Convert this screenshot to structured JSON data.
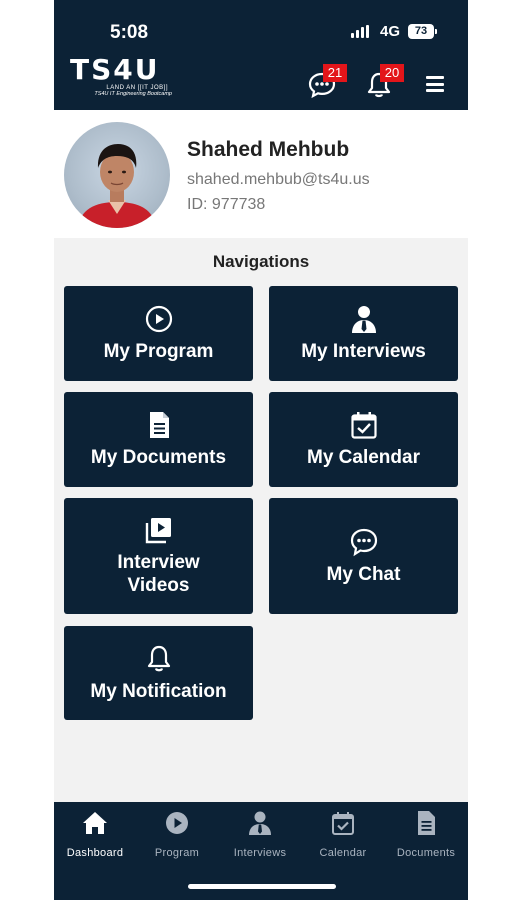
{
  "status_bar": {
    "time": "5:08",
    "network": "4G",
    "battery": "73"
  },
  "header": {
    "logo_text": "TS4U",
    "logo_tagline": "LAND AN [[IT JOB]]",
    "logo_subtitle": "TS4U IT Engineering Bootcamp",
    "chat_badge": "21",
    "notification_badge": "20"
  },
  "profile": {
    "name": "Shahed Mehbub",
    "email": "shahed.mehbub@ts4u.us",
    "id_text": "ID: 977738"
  },
  "navigations": {
    "title": "Navigations",
    "tiles": [
      {
        "label": "My Program",
        "icon": "play-circle-icon"
      },
      {
        "label": "My Interviews",
        "icon": "user-tie-icon"
      },
      {
        "label": "My Documents",
        "icon": "document-icon"
      },
      {
        "label": "My Calendar",
        "icon": "calendar-check-icon"
      },
      {
        "label": "Interview\nVideos",
        "icon": "video-library-icon"
      },
      {
        "label": "My Chat",
        "icon": "chat-bubble-icon"
      },
      {
        "label": "My Notification",
        "icon": "bell-icon"
      }
    ]
  },
  "bottom_nav": {
    "items": [
      {
        "label": "Dashboard",
        "icon": "home-icon"
      },
      {
        "label": "Program",
        "icon": "play-circle-icon"
      },
      {
        "label": "Interviews",
        "icon": "user-tie-icon"
      },
      {
        "label": "Calendar",
        "icon": "calendar-check-icon"
      },
      {
        "label": "Documents",
        "icon": "document-icon"
      }
    ]
  },
  "colors": {
    "primary": "#0c2236",
    "badge": "#e3151a",
    "background": "#f2f2f2"
  }
}
